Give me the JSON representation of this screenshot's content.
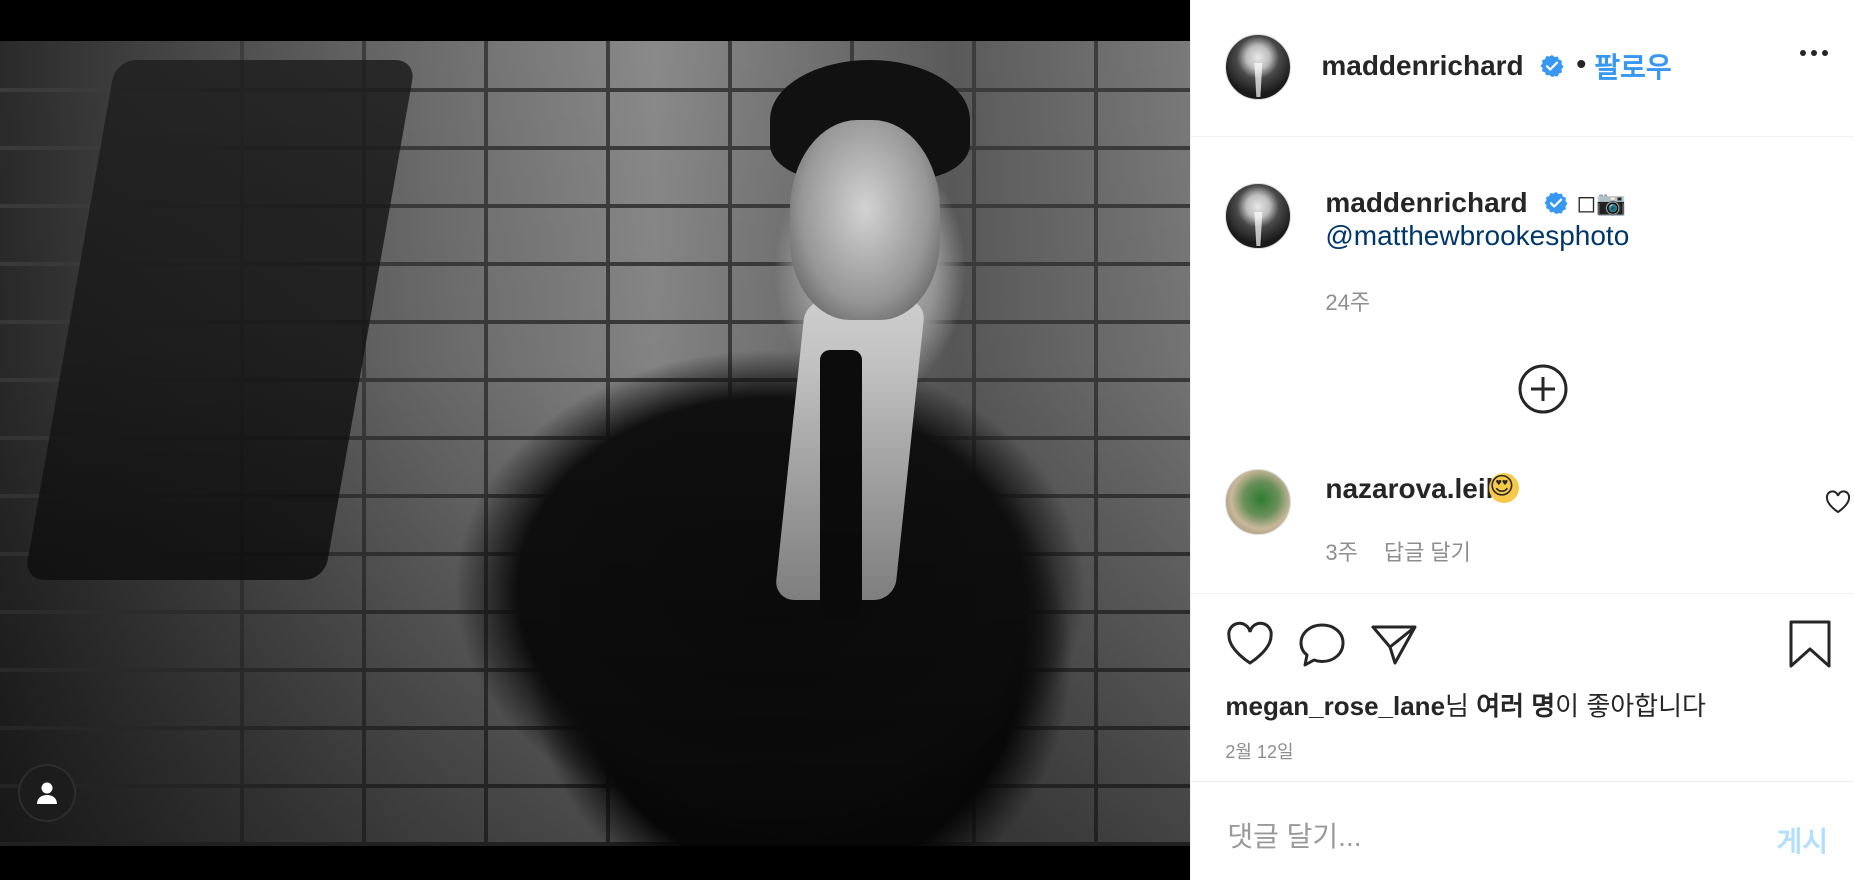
{
  "post": {
    "author": "maddenrichard",
    "follow_label": "팔로우",
    "separator": "•",
    "caption_extra": "◻︎📷",
    "caption_link": "@matthewbrookesphoto",
    "caption_time": "24주"
  },
  "comments": [
    {
      "user": "nazarova.leili",
      "text": "😍",
      "time": "3주",
      "reply_label": "답글 달기"
    }
  ],
  "likes": {
    "liker": "megan_rose_lane",
    "suffix_1": "님 ",
    "others": "여러 명",
    "suffix_2": "이 좋아합니다"
  },
  "post_date": "2월 12일",
  "comment_form": {
    "placeholder": "댓글 달기...",
    "submit_label": "게시"
  },
  "icons": [
    "more-options-icon",
    "verified-badge-icon",
    "load-more-comments-icon",
    "heart-icon",
    "comment-icon",
    "share-icon",
    "save-icon",
    "user-tag-icon"
  ],
  "colors": {
    "link_blue": "#3897f0",
    "mention_blue": "#00376b",
    "muted": "#8e8e8e",
    "post_disabled": "#b2dffc",
    "verified": "#3897f0"
  }
}
